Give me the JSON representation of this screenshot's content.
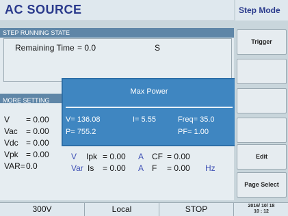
{
  "header": {
    "title": "AC SOURCE",
    "mode": "Step Mode"
  },
  "step_state": {
    "section_label": "STEP RUNNING STATE",
    "remaining_label": "Remaining Time",
    "remaining_value": "= 0.0",
    "remaining_unit": "S"
  },
  "more_settings": {
    "section_label": "MORE SETTING",
    "rows": [
      {
        "label": "V",
        "value": "= 0.00"
      },
      {
        "label": "Vac",
        "value": "= 0.00"
      },
      {
        "label": "Vdc",
        "value": "= 0.00"
      },
      {
        "label": "Vpk",
        "value": "= 0.00"
      },
      {
        "label": "VAR=",
        "value": "0.0"
      }
    ],
    "row4": {
      "v": "V",
      "ipk_label": "Ipk",
      "ipk_value": "= 0.00",
      "ipk_unit": "A",
      "cf_label": "CF",
      "cf_value": "= 0.00"
    },
    "row5": {
      "var": "Var",
      "is_label": "Is",
      "is_value": "= 0.00",
      "is_unit": "A",
      "f_label": "F",
      "f_value": "= 0.00",
      "f_unit": "Hz"
    }
  },
  "popup": {
    "title": "Max Power",
    "v": "V= 136.08",
    "i": "I= 5.55",
    "freq": "Freq= 35.0",
    "p": "P= 755.2",
    "pf": "PF= 1.00"
  },
  "buttons": {
    "trigger": "Trigger",
    "edit": "Edit",
    "page_select": "Page Select"
  },
  "status": {
    "voltage": "300V",
    "control": "Local",
    "state": "STOP",
    "date": "2016/ 10/ 18",
    "time": "10 : 12"
  }
}
